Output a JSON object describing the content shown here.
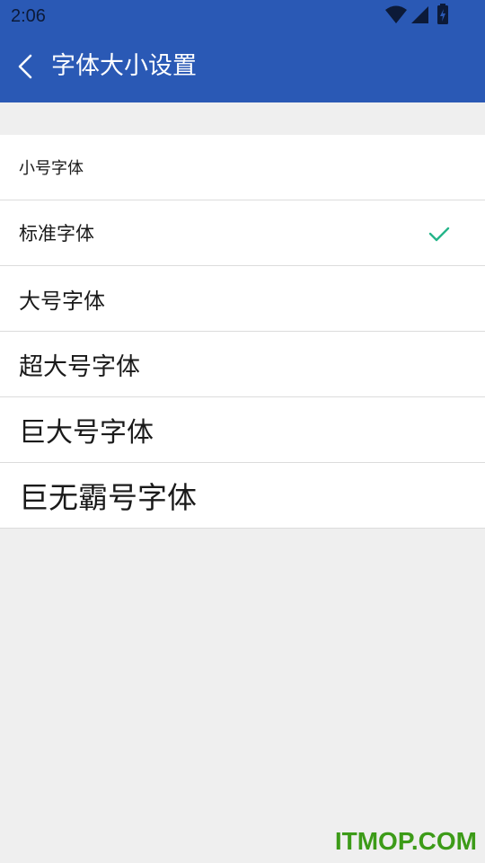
{
  "status_bar": {
    "time": "2:06",
    "icons": [
      "wifi-icon",
      "cellular-signal-icon",
      "battery-charging-icon"
    ]
  },
  "app_bar": {
    "title": "字体大小设置",
    "back_icon": "chevron-left-icon"
  },
  "font_options": [
    {
      "label": "小号字体",
      "selected": false
    },
    {
      "label": "标准字体",
      "selected": true
    },
    {
      "label": "大号字体",
      "selected": false
    },
    {
      "label": "超大号字体",
      "selected": false
    },
    {
      "label": "巨大号字体",
      "selected": false
    },
    {
      "label": "巨无霸号字体",
      "selected": false
    }
  ],
  "selected_indicator_icon": "checkmark-icon",
  "watermark": "ITMOP.COM",
  "colors": {
    "app_bar": "#2a59b5",
    "check": "#26b58a",
    "background": "#efefef",
    "watermark": "#3c9b18"
  }
}
